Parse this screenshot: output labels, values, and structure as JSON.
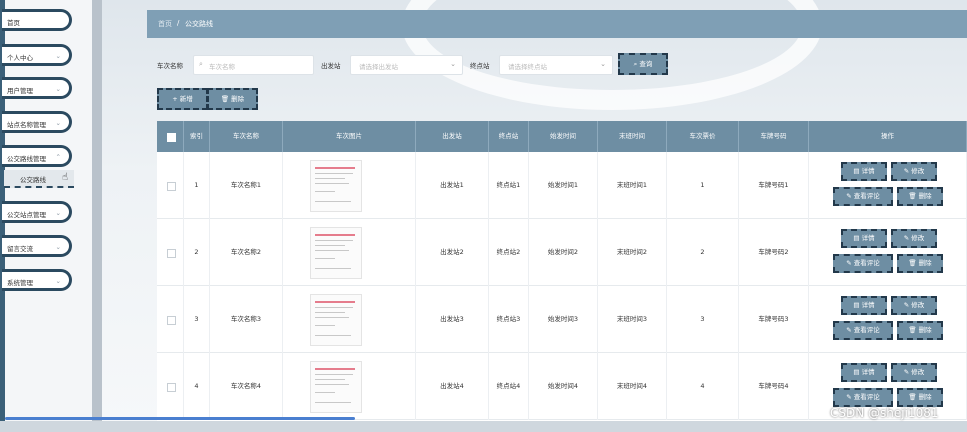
{
  "sidebar": {
    "items": [
      {
        "label": "首页",
        "chevron": false
      },
      {
        "label": "个人中心",
        "chevron": true
      },
      {
        "label": "用户管理",
        "chevron": true
      },
      {
        "label": "站点名称管理",
        "chevron": true
      },
      {
        "label": "公交路线管理",
        "chevron": true
      },
      {
        "label": "公交站点管理",
        "chevron": true
      },
      {
        "label": "留言交流",
        "chevron": true
      },
      {
        "label": "系统管理",
        "chevron": true
      }
    ],
    "subitem": "公交路线"
  },
  "breadcrumb": {
    "home": "首页",
    "separator": "/",
    "current": "公交路线"
  },
  "search": {
    "name_label": "车次名称",
    "name_placeholder": "车次名称",
    "start_label": "出发站",
    "start_placeholder": "请选择出发站",
    "end_label": "终点站",
    "end_placeholder": "请选择终点站",
    "query_button": "查询"
  },
  "toolbar": {
    "add_label": "+ 新增",
    "delete_label": "删除"
  },
  "table": {
    "headers": [
      "索引",
      "车次名称",
      "车次图片",
      "出发站",
      "终点站",
      "始发时间",
      "末班时间",
      "车次票价",
      "车牌号码",
      "操作"
    ],
    "rows": [
      {
        "index": "1",
        "name": "车次名称1",
        "start": "出发站1",
        "end": "终点站1",
        "first": "始发时间1",
        "last": "末班时间1",
        "price": "1",
        "plate": "车牌号码1"
      },
      {
        "index": "2",
        "name": "车次名称2",
        "start": "出发站2",
        "end": "终点站2",
        "first": "始发时间2",
        "last": "末班时间2",
        "price": "2",
        "plate": "车牌号码2"
      },
      {
        "index": "3",
        "name": "车次名称3",
        "start": "出发站3",
        "end": "终点站3",
        "first": "始发时间3",
        "last": "末班时间3",
        "price": "3",
        "plate": "车牌号码3"
      },
      {
        "index": "4",
        "name": "车次名称4",
        "start": "出发站4",
        "end": "终点站4",
        "first": "始发时间4",
        "last": "末班时间4",
        "price": "4",
        "plate": "车牌号码4"
      }
    ],
    "actions": {
      "detail": "详情",
      "edit": "修改",
      "comments": "查看评论",
      "delete": "删除"
    }
  },
  "watermark": "CSDN @sheji1081",
  "colors": {
    "accent": "#6e8ea3",
    "breadcrumb_bar": "#7f9fb5",
    "sidebar_border": "#2b4a60"
  }
}
